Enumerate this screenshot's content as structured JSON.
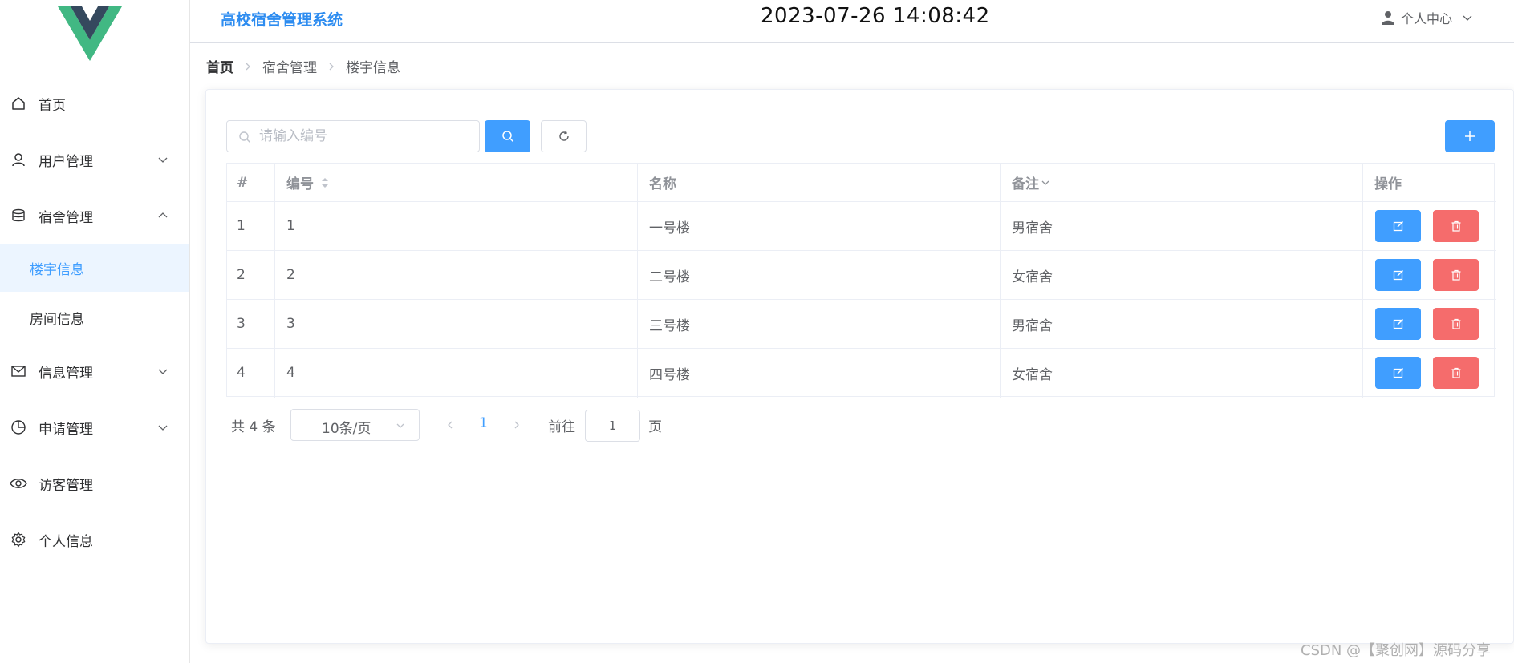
{
  "header": {
    "app_title": "高校宿舍管理系统",
    "clock": "2023-07-26 14:08:42",
    "user_menu_label": "个人中心"
  },
  "sidebar": {
    "items": [
      {
        "label": "首页",
        "icon": "home-icon"
      },
      {
        "label": "用户管理",
        "icon": "user-icon",
        "expanded": false
      },
      {
        "label": "宿舍管理",
        "icon": "database-icon",
        "expanded": true
      },
      {
        "label": "信息管理",
        "icon": "message-icon",
        "expanded": false
      },
      {
        "label": "申请管理",
        "icon": "pie-chart-icon",
        "expanded": false
      },
      {
        "label": "访客管理",
        "icon": "eye-icon"
      },
      {
        "label": "个人信息",
        "icon": "gear-icon"
      }
    ],
    "submenu": [
      {
        "label": "楼宇信息",
        "active": true
      },
      {
        "label": "房间信息",
        "active": false
      }
    ]
  },
  "breadcrumb": [
    "首页",
    "宿舍管理",
    "楼宇信息"
  ],
  "search": {
    "placeholder": "请输入编号",
    "value": ""
  },
  "table": {
    "headers": [
      "#",
      "编号",
      "名称",
      "备注",
      "操作"
    ],
    "rows": [
      {
        "index": "1",
        "code": "1",
        "name": "一号楼",
        "remark": "男宿舍"
      },
      {
        "index": "2",
        "code": "2",
        "name": "二号楼",
        "remark": "女宿舍"
      },
      {
        "index": "3",
        "code": "3",
        "name": "三号楼",
        "remark": "男宿舍"
      },
      {
        "index": "4",
        "code": "4",
        "name": "四号楼",
        "remark": "女宿舍"
      }
    ]
  },
  "pagination": {
    "total": "共 4 条",
    "page_size": "10条/页",
    "current_page": "1",
    "goto_label": "前往",
    "goto_value": "1",
    "page_suffix": "页"
  },
  "watermark": "CSDN @【聚创网】源码分享",
  "colors": {
    "primary": "#409eff",
    "danger": "#f56c6c",
    "title": "#2d8cf0",
    "active_bg": "#ecf5ff",
    "logo_green": "#41b883",
    "logo_dark": "#35495e"
  }
}
